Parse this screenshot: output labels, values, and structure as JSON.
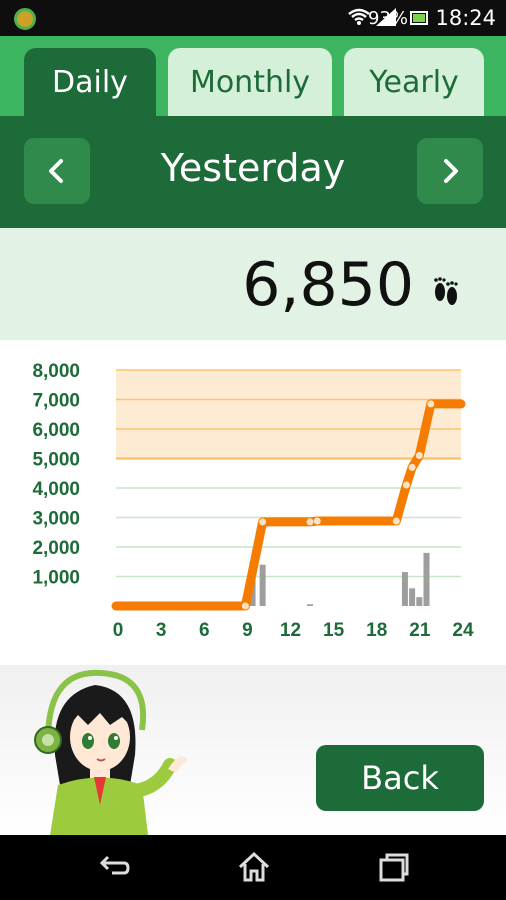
{
  "status_bar": {
    "battery": "93%",
    "time": "18:24"
  },
  "tabs": [
    {
      "label": "Daily",
      "active": true
    },
    {
      "label": "Monthly",
      "active": false
    },
    {
      "label": "Yearly",
      "active": false
    }
  ],
  "date_nav": {
    "title": "Yesterday",
    "prev_icon": "chevron-left-icon",
    "next_icon": "chevron-right-icon"
  },
  "summary": {
    "steps": "6,850",
    "icon": "footprints-icon"
  },
  "chart_data": {
    "type": "line",
    "title": "",
    "xlabel": "",
    "ylabel": "",
    "x_ticks": [
      "0",
      "3",
      "6",
      "9",
      "12",
      "15",
      "18",
      "21",
      "24"
    ],
    "y_ticks": [
      "1,000",
      "2,000",
      "3,000",
      "4,000",
      "5,000",
      "6,000",
      "7,000",
      "8,000"
    ],
    "xlim": [
      0,
      24
    ],
    "ylim": [
      0,
      8000
    ],
    "goal_band": [
      5000,
      8000
    ],
    "colors": {
      "line": "#f57c00",
      "band": "#fdebd3",
      "grid_low": "#c8e6c9",
      "grid_high": "#ffc46b",
      "bars": "#9e9e9e",
      "axis_text": "#1e6b3a"
    },
    "series": [
      {
        "values": [
          [
            0,
            0
          ],
          [
            9,
            0
          ],
          [
            10.2,
            2850
          ],
          [
            13.5,
            2850
          ],
          [
            14,
            2880
          ],
          [
            19.5,
            2880
          ],
          [
            20.2,
            4100
          ],
          [
            20.6,
            4700
          ],
          [
            21.1,
            5100
          ],
          [
            21.9,
            6850
          ],
          [
            24,
            6850
          ]
        ]
      }
    ],
    "hourly_bars": [
      {
        "x": 9.5,
        "value": 1400
      },
      {
        "x": 10.2,
        "value": 1400
      },
      {
        "x": 13.5,
        "value": 60
      },
      {
        "x": 20.1,
        "value": 1150
      },
      {
        "x": 20.6,
        "value": 600
      },
      {
        "x": 21.1,
        "value": 300
      },
      {
        "x": 21.6,
        "value": 1800
      }
    ]
  },
  "bottom": {
    "back_label": "Back"
  }
}
